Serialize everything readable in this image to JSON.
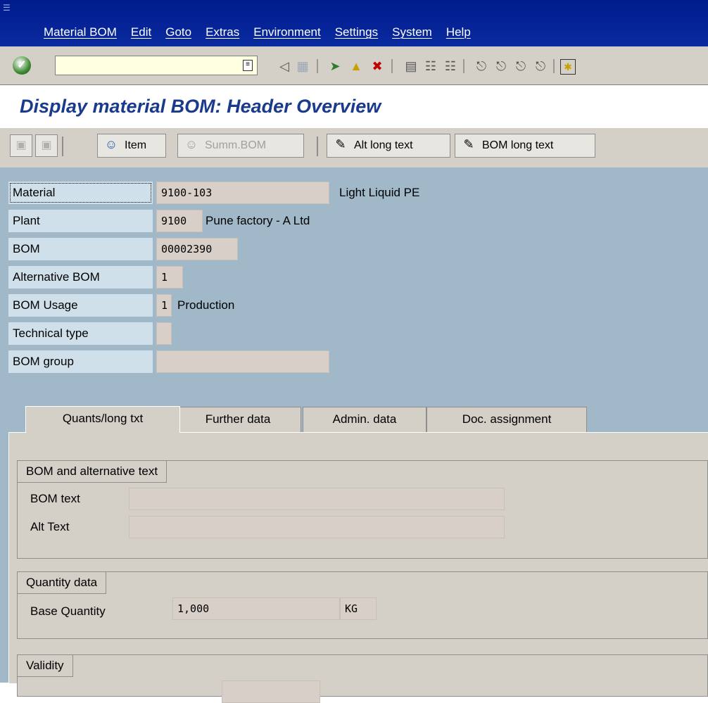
{
  "menu": {
    "items": [
      "Material BOM",
      "Edit",
      "Goto",
      "Extras",
      "Environment",
      "Settings",
      "System",
      "Help"
    ]
  },
  "title": "Display material BOM: Header Overview",
  "app_toolbar": {
    "item": "Item",
    "summ_bom": "Summ.BOM",
    "alt_long_text": "Alt long text",
    "bom_long_text": "BOM long text"
  },
  "header": {
    "material": {
      "label": "Material",
      "value": "9100-103",
      "desc": "Light Liquid PE"
    },
    "plant": {
      "label": "Plant",
      "value": "9100",
      "desc": "Pune factory -  A Ltd"
    },
    "bom": {
      "label": "BOM",
      "value": "00002390"
    },
    "alt_bom": {
      "label": "Alternative BOM",
      "value": "1"
    },
    "usage": {
      "label": "BOM Usage",
      "value": "1",
      "desc": "Production"
    },
    "tech_type": {
      "label": "Technical type",
      "value": ""
    },
    "bom_group": {
      "label": "BOM group",
      "value": ""
    }
  },
  "tabs": [
    "Quants/long txt",
    "Further data",
    "Admin. data",
    "Doc. assignment"
  ],
  "groups": {
    "alt_text": {
      "title": "BOM and alternative text",
      "bom_text_label": "BOM text",
      "alt_text_label": "Alt Text"
    },
    "quantity": {
      "title": "Quantity data",
      "base_qty_label": "Base Quantity",
      "base_qty_value": "1,000",
      "unit": "KG"
    },
    "validity": {
      "title": "Validity"
    }
  }
}
